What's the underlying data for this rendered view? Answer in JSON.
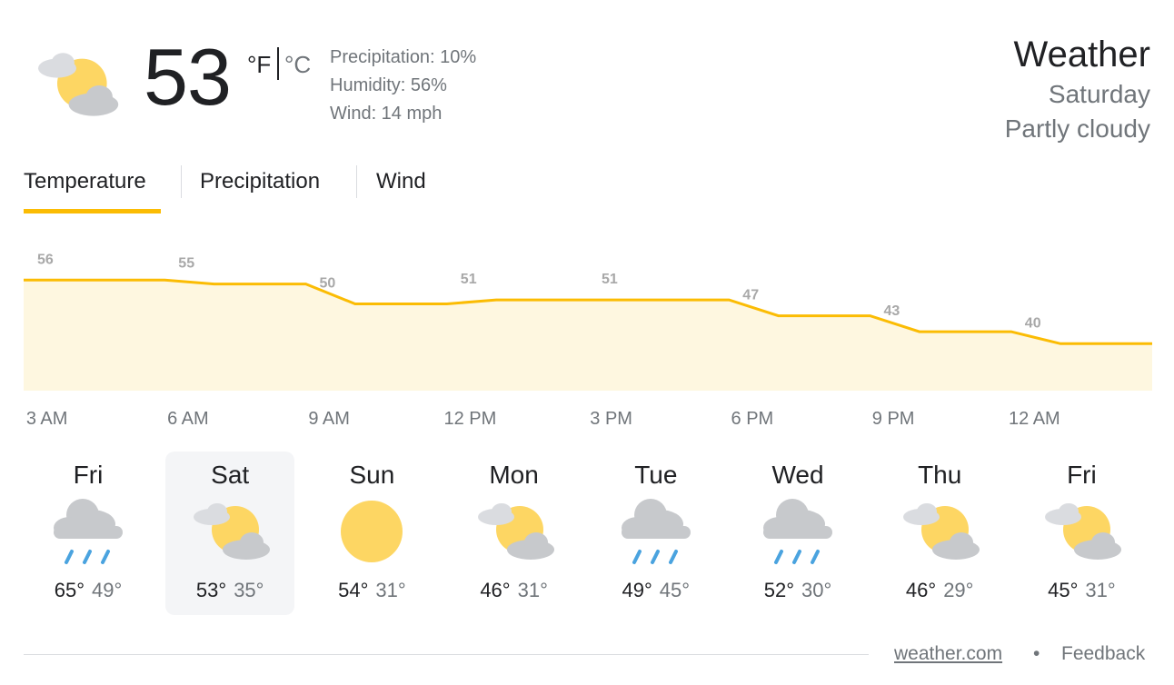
{
  "current": {
    "temp": "53",
    "unit_f": "°F",
    "unit_c": "°C",
    "icon": "partly-cloudy-icon",
    "precipitation": "Precipitation: 10%",
    "humidity": "Humidity: 56%",
    "wind": "Wind: 14 mph"
  },
  "header": {
    "title": "Weather",
    "day": "Saturday",
    "condition": "Partly cloudy"
  },
  "tabs": [
    {
      "label": "Temperature",
      "active": true
    },
    {
      "label": "Precipitation",
      "active": false
    },
    {
      "label": "Wind",
      "active": false
    }
  ],
  "chart_data": {
    "type": "area",
    "x": [
      "3 AM",
      "6 AM",
      "9 AM",
      "12 PM",
      "3 PM",
      "6 PM",
      "9 PM",
      "12 AM"
    ],
    "values": [
      56,
      55,
      50,
      51,
      51,
      47,
      43,
      40
    ],
    "data_labels": [
      "56",
      "55",
      "50",
      "51",
      "51",
      "47",
      "43",
      "40"
    ],
    "color": "#fbbc04",
    "fill": "#fef7e0"
  },
  "hours": [
    "3 AM",
    "6 AM",
    "9 AM",
    "12 PM",
    "3 PM",
    "6 PM",
    "9 PM",
    "12 AM"
  ],
  "days": [
    {
      "name": "Fri",
      "icon": "rain-icon",
      "hi": "65°",
      "lo": "49°",
      "selected": false
    },
    {
      "name": "Sat",
      "icon": "partly-cloudy-icon",
      "hi": "53°",
      "lo": "35°",
      "selected": true
    },
    {
      "name": "Sun",
      "icon": "sunny-icon",
      "hi": "54°",
      "lo": "31°",
      "selected": false
    },
    {
      "name": "Mon",
      "icon": "partly-cloudy-icon",
      "hi": "46°",
      "lo": "31°",
      "selected": false
    },
    {
      "name": "Tue",
      "icon": "rain-icon",
      "hi": "49°",
      "lo": "45°",
      "selected": false
    },
    {
      "name": "Wed",
      "icon": "rain-icon",
      "hi": "52°",
      "lo": "30°",
      "selected": false
    },
    {
      "name": "Thu",
      "icon": "partly-cloudy-icon",
      "hi": "46°",
      "lo": "29°",
      "selected": false
    },
    {
      "name": "Fri",
      "icon": "partly-cloudy-icon",
      "hi": "45°",
      "lo": "31°",
      "selected": false
    }
  ],
  "footer": {
    "source": "weather.com",
    "separator": "•",
    "feedback": "Feedback"
  },
  "colors": {
    "accent": "#fbbc04",
    "sun": "#fdd663",
    "cloud": "#c7c9cc",
    "rain": "#4aa3df"
  }
}
